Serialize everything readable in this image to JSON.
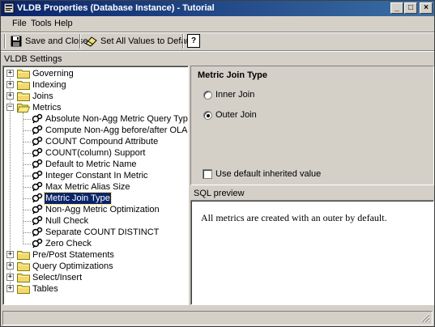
{
  "window": {
    "title": "VLDB Properties (Database Instance) - Tutorial",
    "controls": [
      "_",
      "□",
      "×"
    ]
  },
  "menu": [
    "File",
    "Tools",
    "Help"
  ],
  "toolbar": {
    "save_close": "Save and Close",
    "set_defaults": "Set All Values to Default",
    "help": "?"
  },
  "settings_label": "VLDB Settings",
  "tree": {
    "folders_top": [
      "Governing",
      "Indexing",
      "Joins",
      "Metrics"
    ],
    "metrics_children": [
      "Absolute Non-Agg Metric Query Type",
      "Compute Non-Agg before/after OLAP Funct",
      "COUNT Compound Attribute",
      "COUNT(column) Support",
      "Default to Metric Name",
      "Integer Constant In Metric",
      "Max Metric Alias Size",
      "Metric Join Type",
      "Non-Agg Metric Optimization",
      "Null Check",
      "Separate COUNT DISTINCT",
      "Zero Check"
    ],
    "selected": "Metric Join Type",
    "folders_bottom": [
      "Pre/Post Statements",
      "Query Optimizations",
      "Select/Insert",
      "Tables"
    ]
  },
  "panel": {
    "title": "Metric Join Type",
    "options": [
      {
        "label": "Inner Join",
        "selected": false
      },
      {
        "label": "Outer Join",
        "selected": true
      }
    ],
    "use_default_label": "Use default inherited value",
    "use_default_checked": false
  },
  "sql_preview": {
    "label": "SQL preview",
    "text": "All metrics are created with an outer by default."
  },
  "colors": {
    "title_start": "#0a246a",
    "title_end": "#3a6ea5",
    "face": "#d4d0c8",
    "selection": "#0a246a",
    "folder": "#f5d76e"
  }
}
